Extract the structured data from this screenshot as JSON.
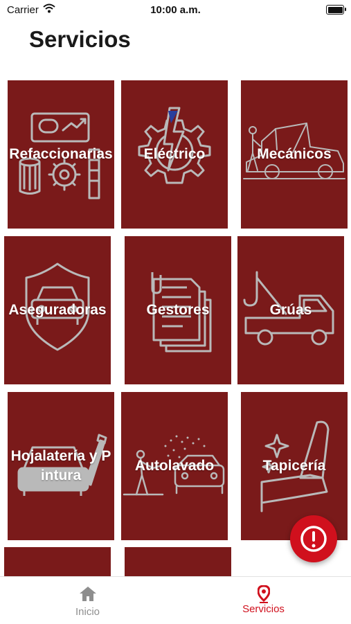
{
  "status_bar": {
    "carrier": "Carrier",
    "time": "10:00 a.m."
  },
  "page": {
    "title": "Servicios"
  },
  "services": [
    {
      "label": "Refaccionarias",
      "icon": "auto-parts-icon"
    },
    {
      "label": "Eléctrico",
      "icon": "electric-gear-icon"
    },
    {
      "label": "Mecánicos",
      "icon": "mechanic-car-icon"
    },
    {
      "label": "Aseguradoras",
      "icon": "insurance-shield-car-icon"
    },
    {
      "label": "Gestores",
      "icon": "documents-icon"
    },
    {
      "label": "Grúas",
      "icon": "tow-truck-icon"
    },
    {
      "label": "Hojalatería y Pintura",
      "icon": "car-paint-brush-icon"
    },
    {
      "label": "Autolavado",
      "icon": "car-wash-icon"
    },
    {
      "label": "Tapicería",
      "icon": "car-seat-icon"
    },
    {
      "label": "",
      "icon": ""
    },
    {
      "label": "",
      "icon": ""
    }
  ],
  "tab_bar": {
    "tabs": [
      {
        "label": "Inicio",
        "icon": "home-icon",
        "active": false
      },
      {
        "label": "Servicios",
        "icon": "location-pin-icon",
        "active": true
      }
    ]
  },
  "fab": {
    "icon": "alert-exclamation-icon"
  },
  "colors": {
    "tile": "#7a1a1a",
    "accent": "#d0101d",
    "inactive_tab": "#8e8e8e",
    "icon_stroke": "#b9b9b9"
  }
}
